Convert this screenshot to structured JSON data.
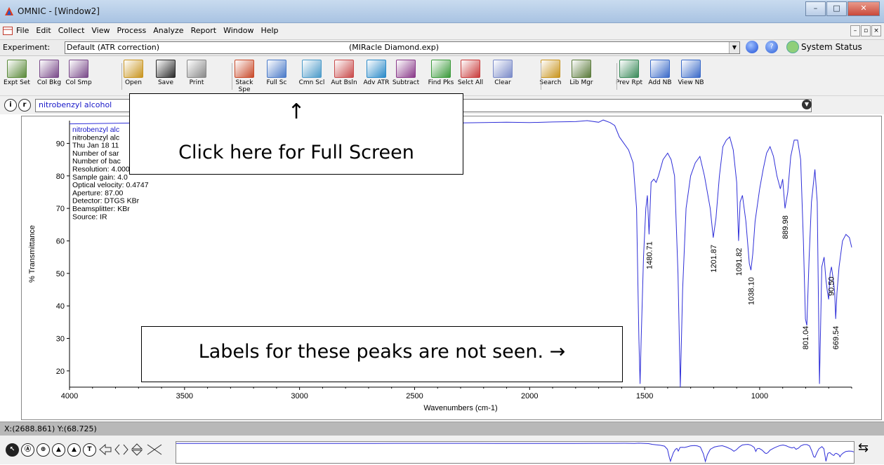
{
  "window": {
    "title": "OMNIC - [Window2]",
    "btn_min": "–",
    "btn_max": "□",
    "btn_close": "✕"
  },
  "menu": [
    "File",
    "Edit",
    "Collect",
    "View",
    "Process",
    "Analyze",
    "Report",
    "Window",
    "Help"
  ],
  "mdi": {
    "min": "–",
    "restore": "▫",
    "close": "×"
  },
  "experiment": {
    "label": "Experiment:",
    "value": "Default (ATR correction)",
    "file": "(MIRacle Diamond.exp)",
    "status_label": "System Status"
  },
  "toolbar": [
    {
      "label": "Expt Set",
      "name": "expt-set-button",
      "color": "#5a8a3a"
    },
    {
      "label": "Col Bkg",
      "name": "col-bkg-button",
      "color": "#7a4a8a"
    },
    {
      "label": "Col Smp",
      "name": "col-smp-button",
      "color": "#7a4a8a"
    },
    {
      "label": "Open",
      "name": "open-button",
      "color": "#c8941e"
    },
    {
      "label": "Save",
      "name": "save-button",
      "color": "#2a2a2a"
    },
    {
      "label": "Print",
      "name": "print-button",
      "color": "#888888"
    },
    {
      "label": "Stack Spe",
      "name": "stack-spectra-button",
      "color": "#c84a2a"
    },
    {
      "label": "Full Sc",
      "name": "full-scale-button",
      "color": "#4a7ac8"
    },
    {
      "label": "Cmn Scl",
      "name": "common-scale-button",
      "color": "#4a9ac8"
    },
    {
      "label": "Aut Bsln",
      "name": "auto-baseline-button",
      "color": "#c84a4a"
    },
    {
      "label": "Adv ATR",
      "name": "adv-atr-button",
      "color": "#2a8ac8"
    },
    {
      "label": "Subtract",
      "name": "subtract-button",
      "color": "#8a3a8a"
    },
    {
      "label": "Find Pks",
      "name": "find-peaks-button",
      "color": "#3a9a3a"
    },
    {
      "label": "Selct All",
      "name": "select-all-button",
      "color": "#c83a3a"
    },
    {
      "label": "Clear",
      "name": "clear-button",
      "color": "#7a8ac8"
    },
    {
      "label": "Search",
      "name": "search-button",
      "color": "#c8941e"
    },
    {
      "label": "Lib Mgr",
      "name": "library-manager-button",
      "color": "#5a7a3a"
    },
    {
      "label": "Prev Rpt",
      "name": "preview-report-button",
      "color": "#3a8a5a"
    },
    {
      "label": "Add NB",
      "name": "add-notebook-button",
      "color": "#3a6ac8"
    },
    {
      "label": "View NB",
      "name": "view-notebook-button",
      "color": "#3a6ac8"
    }
  ],
  "spectrum": {
    "selected": "nitrobenzyl alcohol",
    "info_i": "i",
    "info_r": "r"
  },
  "info_block": [
    "nitrobenzyl alc",
    "nitrobenzyl alc",
    "Thu Jan 18 11",
    "Number of sar",
    "Number of bac",
    "Resolution:  4.000",
    "Sample gain:  4.0",
    "Optical velocity:  0.4747",
    "Aperture:  87.00",
    "Detector:  DTGS KBr",
    "Beamsplitter:  KBr",
    "Source:  IR"
  ],
  "callouts": {
    "full_screen_arrow": "↑",
    "full_screen_text": "Click here for Full Screen",
    "peaks_text": "Labels for these peaks are not seen. →"
  },
  "status": {
    "coords": "X:(2688.861) Y:(68.725)"
  },
  "bottom_tools": [
    "↖",
    "Ⓐ",
    "⊕",
    "▲",
    "▲",
    "T"
  ],
  "chart_data": {
    "type": "line",
    "xlabel": "Wavenumbers (cm-1)",
    "ylabel": "% Transmittance",
    "xlim": [
      4000,
      600
    ],
    "ylim": [
      15,
      97
    ],
    "xticks": [
      4000,
      3500,
      3000,
      2500,
      2000,
      1500,
      1000
    ],
    "yticks": [
      20,
      30,
      40,
      50,
      60,
      70,
      80,
      90
    ],
    "series": [
      {
        "color": "#2f2fd8",
        "points": [
          [
            4000,
            96
          ],
          [
            3800,
            96.2
          ],
          [
            3600,
            96.4
          ],
          [
            3500,
            96.5
          ],
          [
            3400,
            96.4
          ],
          [
            3300,
            96.3
          ],
          [
            3200,
            96.3
          ],
          [
            3100,
            96.4
          ],
          [
            3000,
            96.5
          ],
          [
            2900,
            96.6
          ],
          [
            2800,
            96.7
          ],
          [
            2700,
            96.7
          ],
          [
            2600,
            96.6
          ],
          [
            2500,
            96.6
          ],
          [
            2400,
            96.5
          ],
          [
            2300,
            96.3
          ],
          [
            2200,
            96.4
          ],
          [
            2100,
            96.5
          ],
          [
            2000,
            96.4
          ],
          [
            1900,
            96.6
          ],
          [
            1800,
            96.7
          ],
          [
            1750,
            97
          ],
          [
            1700,
            96.5
          ],
          [
            1680,
            97.2
          ],
          [
            1650,
            96.4
          ],
          [
            1630,
            95.5
          ],
          [
            1610,
            92
          ],
          [
            1590,
            90
          ],
          [
            1570,
            88
          ],
          [
            1550,
            84
          ],
          [
            1535,
            70
          ],
          [
            1525,
            30
          ],
          [
            1520,
            16
          ],
          [
            1515,
            30
          ],
          [
            1505,
            55
          ],
          [
            1495,
            70
          ],
          [
            1488,
            74
          ],
          [
            1480.71,
            62
          ],
          [
            1472,
            78
          ],
          [
            1460,
            79
          ],
          [
            1450,
            78
          ],
          [
            1440,
            80
          ],
          [
            1420,
            85
          ],
          [
            1400,
            87
          ],
          [
            1385,
            85
          ],
          [
            1370,
            80
          ],
          [
            1355,
            50
          ],
          [
            1345,
            15
          ],
          [
            1335,
            45
          ],
          [
            1320,
            70
          ],
          [
            1300,
            80
          ],
          [
            1280,
            84
          ],
          [
            1260,
            86
          ],
          [
            1240,
            80
          ],
          [
            1215,
            70
          ],
          [
            1201.87,
            61
          ],
          [
            1190,
            67
          ],
          [
            1175,
            80
          ],
          [
            1160,
            89
          ],
          [
            1145,
            91
          ],
          [
            1130,
            92
          ],
          [
            1115,
            88
          ],
          [
            1100,
            78
          ],
          [
            1091.82,
            60
          ],
          [
            1085,
            72
          ],
          [
            1075,
            74
          ],
          [
            1060,
            66
          ],
          [
            1045,
            53
          ],
          [
            1038.1,
            51
          ],
          [
            1030,
            56
          ],
          [
            1020,
            66
          ],
          [
            1000,
            76
          ],
          [
            985,
            82
          ],
          [
            970,
            87
          ],
          [
            955,
            89
          ],
          [
            940,
            86
          ],
          [
            925,
            80
          ],
          [
            910,
            76
          ],
          [
            900,
            79
          ],
          [
            889.98,
            70
          ],
          [
            878,
            75
          ],
          [
            865,
            86
          ],
          [
            850,
            91
          ],
          [
            835,
            91
          ],
          [
            822,
            85
          ],
          [
            810,
            60
          ],
          [
            801.04,
            36
          ],
          [
            795,
            34
          ],
          [
            785,
            55
          ],
          [
            775,
            72
          ],
          [
            760,
            82
          ],
          [
            750,
            72
          ],
          [
            740,
            16
          ],
          [
            730,
            52
          ],
          [
            720,
            55
          ],
          [
            712,
            48
          ],
          [
            705,
            44
          ],
          [
            700,
            42
          ],
          [
            694,
            50
          ],
          [
            688,
            52
          ],
          [
            680,
            48
          ],
          [
            674,
            44
          ],
          [
            669.54,
            36
          ],
          [
            664,
            44
          ],
          [
            655,
            52
          ],
          [
            640,
            60
          ],
          [
            625,
            62
          ],
          [
            610,
            61
          ],
          [
            600,
            58
          ]
        ]
      }
    ],
    "peak_labels": [
      {
        "x": 1480.71,
        "text": "1480.71"
      },
      {
        "x": 1201.87,
        "text": "1201.87"
      },
      {
        "x": 1091.82,
        "text": "1091.82"
      },
      {
        "x": 1038.1,
        "text": "1038.10"
      },
      {
        "x": 889.98,
        "text": "889.98"
      },
      {
        "x": 801.04,
        "text": "801.04"
      },
      {
        "x": 669.54,
        "text": "669.54"
      },
      {
        "x": 690.5,
        "text": "90.50"
      }
    ]
  }
}
